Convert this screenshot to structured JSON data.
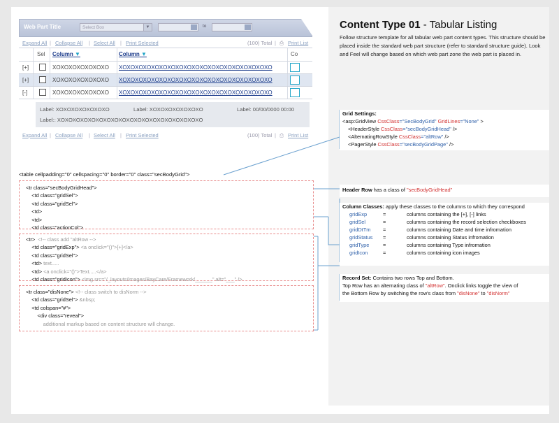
{
  "title": {
    "bold": "Content Type 01",
    "rest": " - Tabular Listing"
  },
  "intro": "Follow structure template for all tabular web part content types. This structure should be placed inside the standard web part structure (refer to standard structure guide). Look and Feel will change based on which web part zone the web part is placed in.",
  "webpart": {
    "title": "Web Part Title",
    "select_placeholder": "Select Box",
    "to_label": "to",
    "links": [
      "Expand All",
      "Collapse All",
      "Select All",
      "Print Selected"
    ],
    "count": "(100) Total",
    "print_list": "Print List",
    "columns": {
      "sel": "Sel",
      "col1": "Column",
      "col2": "Column",
      "co": "Co"
    },
    "rows": [
      {
        "exp": "[+]",
        "text": "XOXOXOXOXOXOXO",
        "link": "XOXOXOXOXOXOXOXOXOXOXOXOXOXOXOXOXOXOXO"
      },
      {
        "exp": "[+]",
        "text": "XOXOXOXOXOXOXO",
        "link": "XOXOXOXOXOXOXOXOXOXOXOXOXOXOXOXOXOXOXO"
      },
      {
        "exp": "[-]",
        "text": "XOXOXOXOXOXOXO",
        "link": "XOXOXOXOXOXOXOXOXOXOXOXOXOXOXOXOXOXOXO"
      }
    ],
    "detail": {
      "label1": "Label: XOXOXOXOXOXOXO",
      "label2": "Label: XOXOXOXOXOXOXO",
      "label3": "Label: 00/00/0000 00:00",
      "label4": "Label:: XOXOXOXOXOXOXOXOXOXOXOXOXOXOXOXOXOXOXO"
    }
  },
  "code": {
    "table": "<table cellpadding=\"0\" cellspacing=\"0\" border=\"0\" class=\"secBodyGrid\">",
    "head": [
      "<tr class=\"secBodyGridHead\">",
      "    <td class=\"gridSel\">",
      "    <td class=\"gridSel\">",
      "    <td>",
      "    <td>",
      "    <td class=\"actionCol\">"
    ],
    "row1": [
      "<tr>",
      "  <!-- class add \"altRow -->",
      "    <td class=\"gridExp\">",
      " <a onclick=\"()\">[+]</a>",
      "    <td class=\"gridSel\">",
      "    <td>",
      " text.....",
      "    <td>",
      " <a onclick=\"()\">Text.....</a>",
      "    <td class=\"gridIcon\">",
      " <img src=\"/_layouts/images/BayCare/Framework/______\" alt=\"___\" />"
    ],
    "row2": [
      "<tr class=\"disNone\">",
      " <!-- class switch to disNorm -->",
      "    <td class=\"gridSel\">",
      " &nbsp;",
      "    <td colspan=\"#\">",
      "        <div class=\"reveal\">",
      "            additional markup based on content structure will change."
    ]
  },
  "grid_settings": {
    "heading": "Grid Settings:",
    "l1a": "<asp:GridView  ",
    "l1b": "CssClass",
    "l1c": "=\"SecBodyGrid\"",
    "l1d": " GridLines",
    "l1e": "=\"None\"",
    "l1f": " >",
    "l2a": "<HeaderStyle ",
    "l2b": "CssClass",
    "l2c": "=\"secBodyGridHead\"",
    "l2d": " />",
    "l3a": "<AlternatingRowStyle ",
    "l3b": "CssClass",
    "l3c": "=\"altRow\"",
    "l3d": " />",
    "l4a": "<PagerStyle ",
    "l4b": "CssClass",
    "l4c": "=\"secBodyGridPage\"",
    "l4d": " />"
  },
  "header_row": {
    "bold": "Header Row",
    "text": " has a class of ",
    "cls": "\"secBodyGridHead\""
  },
  "column_classes": {
    "bold": "Column Classes:",
    "text": " apply these classes to the columns to which they correspond",
    "items": [
      {
        "name": "gridExp",
        "eq": "=",
        "desc": "columns containing the [+], [-] links"
      },
      {
        "name": "gridSel",
        "eq": "=",
        "desc": "columns containing the record selection checkboxes"
      },
      {
        "name": "gridDtTm",
        "eq": "=",
        "desc": "columns containing Date and time infromation"
      },
      {
        "name": "gridStatus",
        "eq": "=",
        "desc": "columns containing Status infromation"
      },
      {
        "name": "gridType",
        "eq": "=",
        "desc": "columns containing Type infromation"
      },
      {
        "name": "gridIcon",
        "eq": "=",
        "desc": "columns containing icon images"
      }
    ]
  },
  "record_set": {
    "bold": "Record Set:",
    "l1": " Contains two rows Top and Bottom.",
    "l2a": "Top Row has an alternating class of ",
    "l2b": "\"altRow\"",
    "l2c": ". Onclick links toggle the view of",
    "l3a": "the Bottom Row by switching the row's class from ",
    "l3b": "\"disNone\"",
    "l3c": " to ",
    "l3d": "\"disNorm\""
  },
  "colors": {
    "accent_link": "#1a3a8a",
    "class_red": "#d23030",
    "blue": "#2c5ea8",
    "icon_border": "#23a6c9",
    "dash": "#e88c8c"
  }
}
